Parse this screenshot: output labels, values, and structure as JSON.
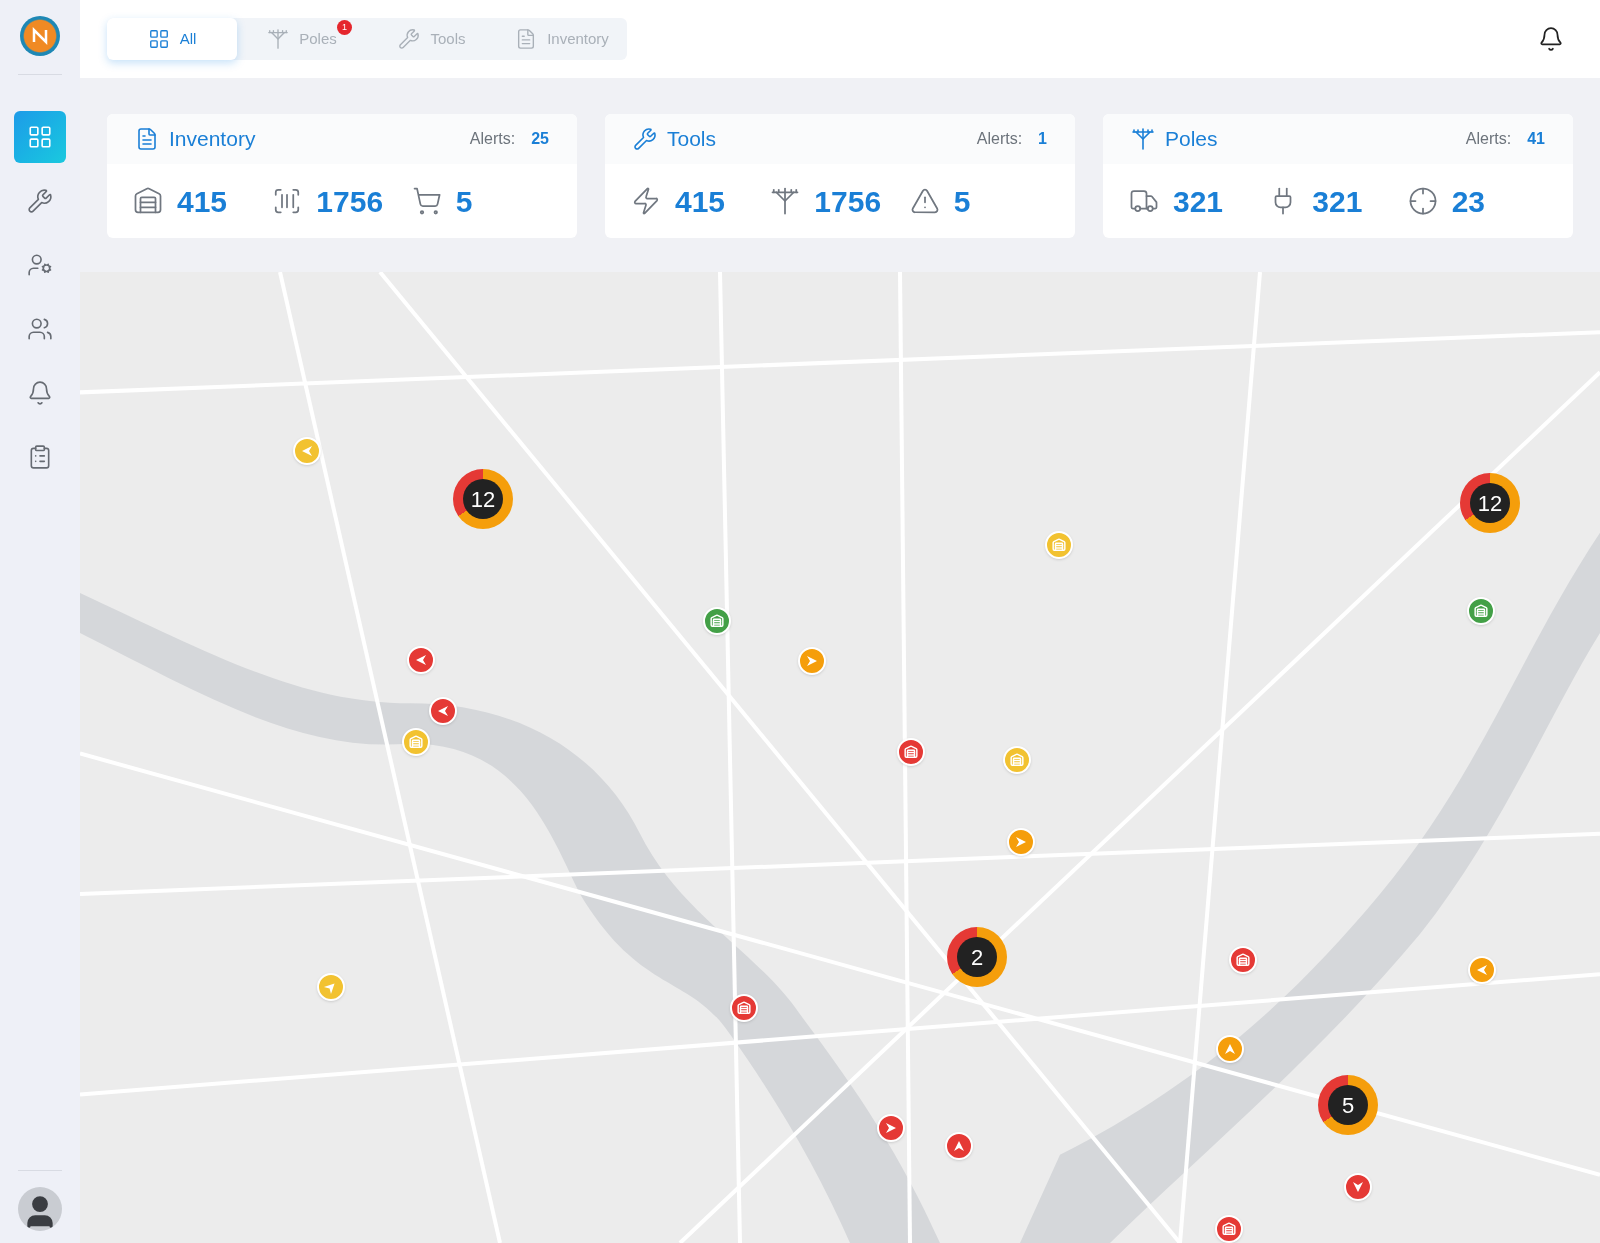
{
  "sidebar": {
    "items": [
      {
        "selected": true
      },
      {
        "selected": false
      },
      {
        "selected": false
      },
      {
        "selected": false
      },
      {
        "selected": false
      },
      {
        "selected": false
      }
    ]
  },
  "tabs": [
    {
      "label": "All",
      "selected": true
    },
    {
      "label": "Poles",
      "selected": false,
      "badge": "1"
    },
    {
      "label": "Tools",
      "selected": false
    },
    {
      "label": "Inventory",
      "selected": false
    }
  ],
  "cards": [
    {
      "title": "Inventory",
      "alerts_label": "Alerts:",
      "alerts": "25",
      "stats": [
        "415",
        "1756",
        "5"
      ]
    },
    {
      "title": "Tools",
      "alerts_label": "Alerts:",
      "alerts": "1",
      "stats": [
        "415",
        "1756",
        "5"
      ]
    },
    {
      "title": "Poles",
      "alerts_label": "Alerts:",
      "alerts": "41",
      "stats": [
        "321",
        "321",
        "23"
      ]
    }
  ],
  "map": {
    "clusters": [
      {
        "count": "12"
      },
      {
        "count": "12"
      },
      {
        "count": "2"
      },
      {
        "count": "5"
      }
    ],
    "markers": [
      {
        "kind": "arrow-left",
        "color": "#f2c230"
      },
      {
        "kind": "arrow-left",
        "color": "#e53935"
      },
      {
        "kind": "arrow-left",
        "color": "#e53935"
      },
      {
        "kind": "depot",
        "color": "#f2c230"
      },
      {
        "kind": "depot",
        "color": "#43a047"
      },
      {
        "kind": "arrow-right",
        "color": "#f59e0b"
      },
      {
        "kind": "depot",
        "color": "#f2c230"
      },
      {
        "kind": "depot",
        "color": "#43a047"
      },
      {
        "kind": "depot",
        "color": "#e53935"
      },
      {
        "kind": "depot",
        "color": "#f2c230"
      },
      {
        "kind": "arrow-right",
        "color": "#f59e0b"
      },
      {
        "kind": "depot",
        "color": "#e53935"
      },
      {
        "kind": "arrow-left",
        "color": "#f59e0b"
      },
      {
        "kind": "arrow-upright",
        "color": "#f2c230"
      },
      {
        "kind": "depot",
        "color": "#e53935"
      },
      {
        "kind": "arrow-up",
        "color": "#f59e0b"
      },
      {
        "kind": "arrow-right",
        "color": "#e53935"
      },
      {
        "kind": "arrow-up",
        "color": "#e53935"
      },
      {
        "kind": "arrow-down",
        "color": "#e53935"
      },
      {
        "kind": "depot",
        "color": "#e53935"
      }
    ]
  }
}
